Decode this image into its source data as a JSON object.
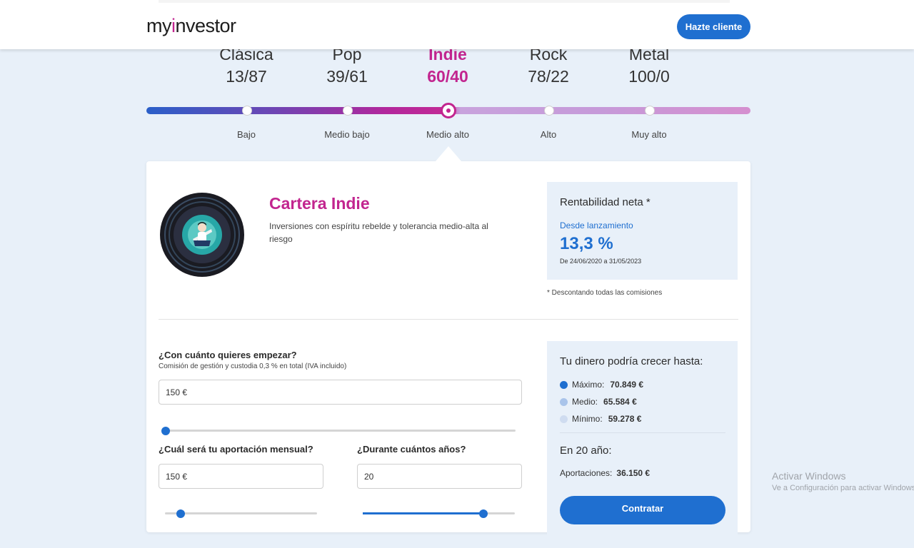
{
  "header": {
    "logo_main": "my",
    "logo_accent": "i",
    "logo_rest": "nvestor",
    "cta_label": "Hazte cliente"
  },
  "portfolios": [
    {
      "name": "Clásica",
      "ratio": "13/87"
    },
    {
      "name": "Pop",
      "ratio": "39/61"
    },
    {
      "name": "Indie",
      "ratio": "60/40"
    },
    {
      "name": "Rock",
      "ratio": "78/22"
    },
    {
      "name": "Metal",
      "ratio": "100/0"
    }
  ],
  "selected_portfolio_index": 2,
  "risk_levels": [
    "Bajo",
    "Medio bajo",
    "Medio alto",
    "Alto",
    "Muy alto"
  ],
  "card": {
    "title": "Cartera Indie",
    "description": "Inversiones con espíritu rebelde y tolerancia medio-alta al riesgo",
    "rentabilidad": {
      "title": "Rentabilidad neta *",
      "subtitle": "Desde lanzamiento",
      "value": "13,3 %",
      "dates": "De 24/06/2020 a 31/05/2023",
      "note": "* Descontando todas las comisiones"
    }
  },
  "form": {
    "initial_question": "¿Con cuánto quieres empezar?",
    "initial_hint": "Comisión de gestión y custodia 0,3 % en total (IVA incluido)",
    "initial_value": "150 €",
    "monthly_question": "¿Cuál será tu aportación mensual?",
    "monthly_value": "150 €",
    "years_question": "¿Durante cuántos años?",
    "years_value": "20"
  },
  "growth": {
    "title": "Tu dinero podría crecer hasta:",
    "max_label": "Máximo:",
    "max_value": "70.849 €",
    "mid_label": "Medio:",
    "mid_value": "65.584 €",
    "min_label": "Mínimo:",
    "min_value": "59.278 €",
    "years_text": "En 20 año:",
    "aport_label": "Aportaciones:",
    "aport_value": "36.150 €",
    "button": "Contratar"
  },
  "colors": {
    "accent_magenta": "#c2258f",
    "primary_blue": "#1f6fd0",
    "legend_max": "#1f6fd0",
    "legend_mid": "#a9c4ea",
    "legend_min": "#cfdcf0"
  },
  "watermark": {
    "line1": "Activar Windows",
    "line2": "Ve a Configuración para activar Windows."
  }
}
